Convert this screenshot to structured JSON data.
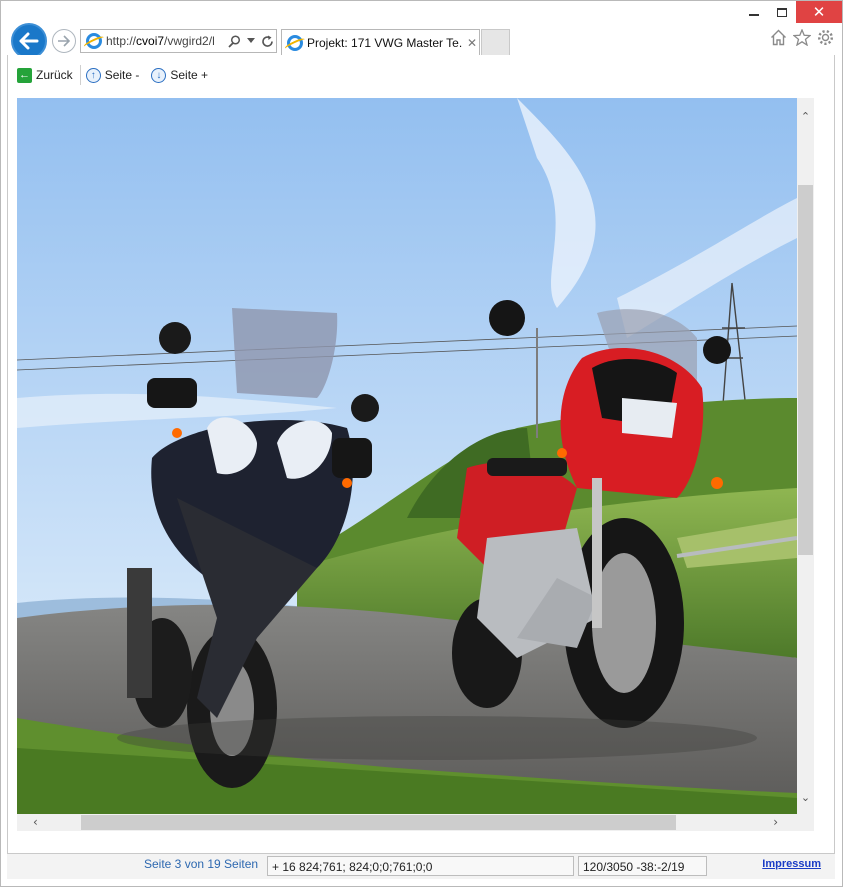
{
  "browser": {
    "address_scheme": "http://",
    "address_domain": "cvoi7",
    "address_path": "/vwgird2/l",
    "tab_title": "Projekt: 171 VWG Master Te...",
    "tab_close": "✕",
    "window_close": "✕",
    "icons": [
      "back-arrow-icon",
      "forward-arrow-icon",
      "ie-logo-icon",
      "search-icon",
      "refresh-icon",
      "home-icon",
      "star-icon",
      "gear-icon"
    ]
  },
  "toolbar": {
    "back_label": "Zurück",
    "page_up_label": "Seite -",
    "page_down_label": "Seite +"
  },
  "image": {
    "description_colors": {
      "sky": "#a9cdf4",
      "grass": "#6f9b3a",
      "road": "#6e6d6b",
      "red_bike": "#d81d23"
    }
  },
  "status": {
    "page_info": "Seite 3 von 19 Seiten",
    "coords": "+ 16 824;761; 824;0;0;761;0;0",
    "position": "120/3050 -38:-2/19",
    "impressum": "Impressum"
  }
}
